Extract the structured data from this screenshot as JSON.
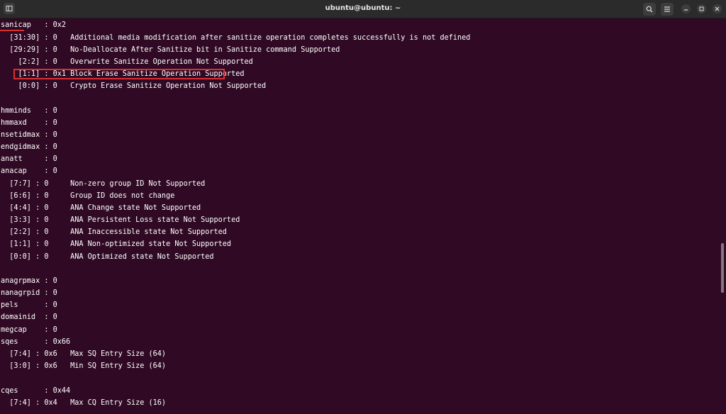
{
  "window": {
    "title": "ubuntu@ubuntu: ~"
  },
  "icons": {
    "new_tab": "new-tab-icon",
    "search": "search-icon",
    "menu": "hamburger-menu-icon",
    "minimize": "minimize-icon",
    "restore": "restore-icon",
    "close": "close-icon"
  },
  "colors": {
    "background": "#300a24",
    "highlight": "#d93030"
  },
  "terminal": {
    "lines": [
      "sanicap   : 0x2",
      "  [31:30] : 0   Additional media modification after sanitize operation completes successfully is not defined",
      "  [29:29] : 0   No-Deallocate After Sanitize bit in Sanitize command Supported",
      "    [2:2] : 0   Overwrite Sanitize Operation Not Supported",
      "    [1:1] : 0x1 Block Erase Sanitize Operation Supported",
      "    [0:0] : 0   Crypto Erase Sanitize Operation Not Supported",
      "",
      "hmminds   : 0",
      "hmmaxd    : 0",
      "nsetidmax : 0",
      "endgidmax : 0",
      "anatt     : 0",
      "anacap    : 0",
      "  [7:7] : 0     Non-zero group ID Not Supported",
      "  [6:6] : 0     Group ID does not change",
      "  [4:4] : 0     ANA Change state Not Supported",
      "  [3:3] : 0     ANA Persistent Loss state Not Supported",
      "  [2:2] : 0     ANA Inaccessible state Not Supported",
      "  [1:1] : 0     ANA Non-optimized state Not Supported",
      "  [0:0] : 0     ANA Optimized state Not Supported",
      "",
      "anagrpmax : 0",
      "nanagrpid : 0",
      "pels      : 0",
      "domainid  : 0",
      "megcap    : 0",
      "sqes      : 0x66",
      "  [7:4] : 0x6   Max SQ Entry Size (64)",
      "  [3:0] : 0x6   Min SQ Entry Size (64)",
      "",
      "cqes      : 0x44",
      "  [7:4] : 0x4   Max CQ Entry Size (16)"
    ]
  }
}
